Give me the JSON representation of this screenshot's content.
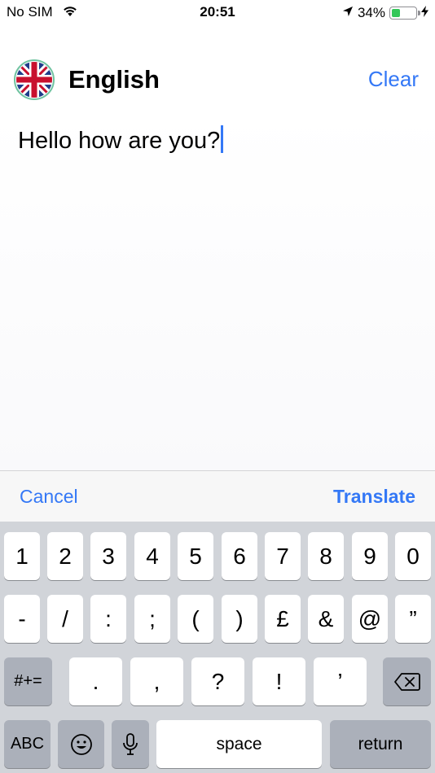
{
  "status_bar": {
    "carrier": "No SIM",
    "time": "20:51",
    "battery_percent": "34%",
    "battery_level": 0.34,
    "icons": [
      "wifi-icon",
      "location-arrow-icon",
      "battery-icon",
      "charging-bolt-icon"
    ]
  },
  "header": {
    "flag_icon": "uk-flag-icon",
    "language": "English",
    "clear_label": "Clear"
  },
  "editor": {
    "text": "Hello how are you?"
  },
  "accessory_bar": {
    "cancel_label": "Cancel",
    "translate_label": "Translate"
  },
  "keyboard": {
    "row1": [
      "1",
      "2",
      "3",
      "4",
      "5",
      "6",
      "7",
      "8",
      "9",
      "0"
    ],
    "row2": [
      "-",
      "/",
      ":",
      ";",
      "(",
      ")",
      "£",
      "&",
      "@",
      "”"
    ],
    "row3": {
      "shift": "#+=",
      "keys": [
        ".",
        ",",
        "?",
        "!",
        "’"
      ],
      "delete_icon": "backspace-icon"
    },
    "row4": {
      "abc": "ABC",
      "emoji_icon": "emoji-icon",
      "mic_icon": "microphone-icon",
      "space": "space",
      "return": "return"
    }
  },
  "colors": {
    "accent": "#3478f6",
    "keyboard_bg": "#d1d4d9",
    "key_dark": "#abb0ba",
    "battery": "#34c759"
  }
}
